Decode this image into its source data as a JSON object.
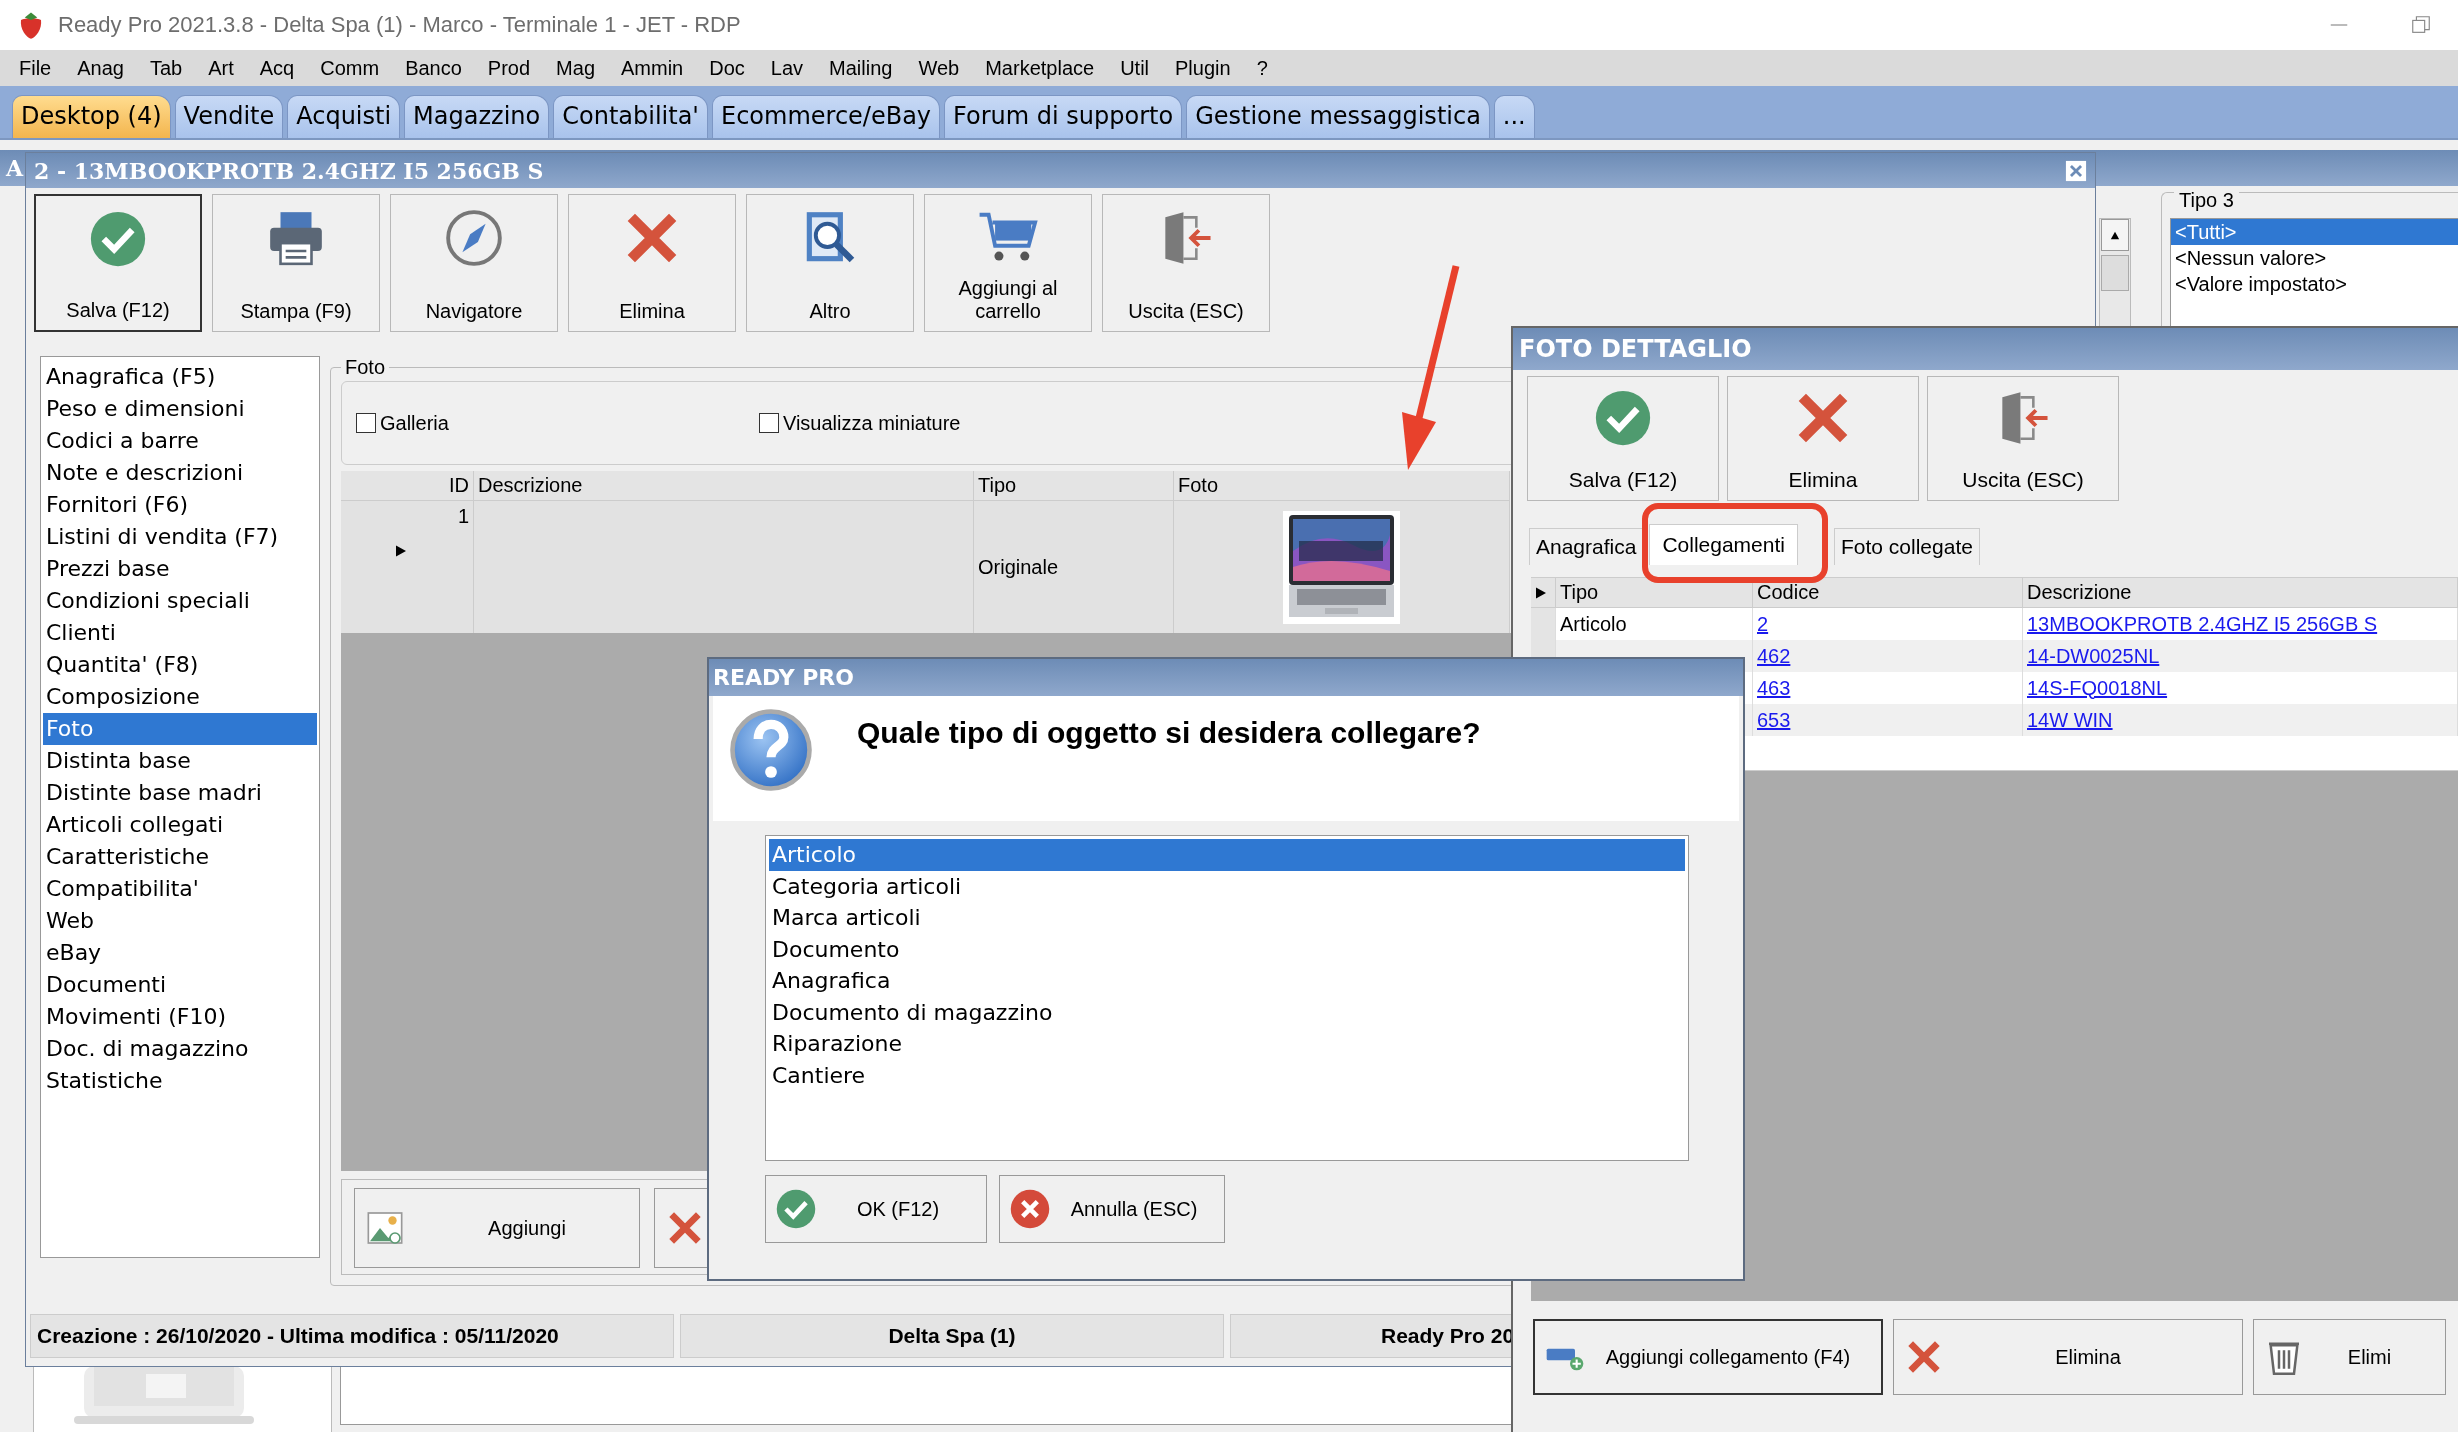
{
  "window": {
    "title": "Ready Pro 2021.3.8 - Delta Spa (1) - Marco - Terminale 1 - JET - RDP",
    "menu": [
      "File",
      "Anag",
      "Tab",
      "Art",
      "Acq",
      "Comm",
      "Banco",
      "Prod",
      "Mag",
      "Ammin",
      "Doc",
      "Lav",
      "Mailing",
      "Web",
      "Marketplace",
      "Util",
      "Plugin",
      "?"
    ],
    "tabs": [
      {
        "label": "Desktop (4)",
        "selected": true
      },
      {
        "label": "Vendite",
        "selected": false
      },
      {
        "label": "Acquisti",
        "selected": false
      },
      {
        "label": "Magazzino",
        "selected": false
      },
      {
        "label": "Contabilita'",
        "selected": false
      },
      {
        "label": "Ecommerce/eBay",
        "selected": false
      },
      {
        "label": "Forum di supporto",
        "selected": false
      },
      {
        "label": "Gestione messaggistica",
        "selected": false
      },
      {
        "label": "...",
        "selected": false
      }
    ]
  },
  "background_window": {
    "title": "A",
    "tipo3": {
      "title": "Tipo 3",
      "items": [
        {
          "label": "<Tutti>",
          "selected": true
        },
        {
          "label": "<Nessun valore>",
          "selected": false
        },
        {
          "label": "<Valore impostato>",
          "selected": false
        }
      ]
    }
  },
  "article_window": {
    "title": "2 - 13MBOOKPROTB 2.4GHZ I5 256GB S",
    "toolbar": [
      {
        "kind": "save",
        "label": "Salva (F12)",
        "focused": true
      },
      {
        "kind": "print",
        "label": "Stampa (F9)",
        "focused": false
      },
      {
        "kind": "navigate",
        "label": "Navigatore",
        "focused": false
      },
      {
        "kind": "delete",
        "label": "Elimina",
        "focused": false
      },
      {
        "kind": "search",
        "label": "Altro",
        "focused": false
      },
      {
        "kind": "cart",
        "label": "Aggiungi al carrello",
        "focused": false
      },
      {
        "kind": "exit",
        "label": "Uscita (ESC)",
        "focused": false
      }
    ],
    "sections": [
      {
        "label": "Anagrafica (F5)",
        "selected": false
      },
      {
        "label": "Peso e dimensioni",
        "selected": false
      },
      {
        "label": "Codici a barre",
        "selected": false
      },
      {
        "label": "Note e descrizioni",
        "selected": false
      },
      {
        "label": "Fornitori (F6)",
        "selected": false
      },
      {
        "label": "Listini di vendita (F7)",
        "selected": false
      },
      {
        "label": "Prezzi base",
        "selected": false
      },
      {
        "label": "Condizioni speciali",
        "selected": false
      },
      {
        "label": "Clienti",
        "selected": false
      },
      {
        "label": "Quantita' (F8)",
        "selected": false
      },
      {
        "label": "Composizione",
        "selected": false
      },
      {
        "label": "Foto",
        "selected": true
      },
      {
        "label": "Distinta base",
        "selected": false
      },
      {
        "label": "Distinte base madri",
        "selected": false
      },
      {
        "label": "Articoli collegati",
        "selected": false
      },
      {
        "label": "Caratteristiche",
        "selected": false
      },
      {
        "label": "Compatibilita'",
        "selected": false
      },
      {
        "label": "Web",
        "selected": false
      },
      {
        "label": "eBay",
        "selected": false
      },
      {
        "label": "Documenti",
        "selected": false
      },
      {
        "label": "Movimenti (F10)",
        "selected": false
      },
      {
        "label": "Doc. di magazzino",
        "selected": false
      },
      {
        "label": "Statistiche",
        "selected": false
      }
    ],
    "photo_group": {
      "title": "Foto",
      "checkboxes": [
        {
          "label": "Galleria",
          "checked": false
        },
        {
          "label": "Visualizza miniature",
          "checked": false
        }
      ],
      "grid": {
        "columns": [
          "ID",
          "Descrizione",
          "Tipo",
          "Foto"
        ],
        "rows": [
          {
            "current": true,
            "id": "1",
            "tipo": "Originale"
          }
        ]
      },
      "buttons": [
        {
          "kind": "image-add",
          "label": "Aggiungi"
        },
        {
          "kind": "delete"
        }
      ]
    },
    "status_bar": [
      "Creazione : 26/10/2020 - Ultima modifica : 05/11/2020",
      "Delta Spa (1)",
      "Ready Pro 20"
    ]
  },
  "photo_detail_window": {
    "title": "FOTO DETTAGLIO",
    "toolbar": [
      {
        "kind": "save",
        "label": "Salva (F12)"
      },
      {
        "kind": "delete",
        "label": "Elimina"
      },
      {
        "kind": "exit",
        "label": "Uscita (ESC)"
      }
    ],
    "tabs": [
      {
        "label": "Anagrafica",
        "selected": false
      },
      {
        "label": "Collegamenti",
        "selected": true
      },
      {
        "label": "Foto collegate",
        "selected": false
      }
    ],
    "grid": {
      "columns": [
        "Tipo",
        "Codice",
        "Descrizione"
      ],
      "rows": [
        {
          "tipo": "Articolo",
          "codice": "2",
          "descrizione": "13MBOOKPROTB 2.4GHZ I5 256GB S"
        },
        {
          "codice": "462",
          "descrizione": "14-DW0025NL"
        },
        {
          "codice": "463",
          "descrizione": "14S-FQ0018NL"
        },
        {
          "codice": "653",
          "descrizione": "14W WIN"
        }
      ]
    },
    "buttons": [
      {
        "kind": "link-add",
        "label": "Aggiungi collegamento (F4)",
        "focused": true
      },
      {
        "kind": "delete",
        "label": "Elimina",
        "focused": false
      },
      {
        "kind": "trash",
        "label": "Elimi",
        "focused": false
      }
    ]
  },
  "dialog": {
    "title": "READY PRO",
    "question": "Quale tipo di oggetto si desidera collegare?",
    "options": [
      {
        "label": "Articolo",
        "selected": true
      },
      {
        "label": "Categoria articoli",
        "selected": false
      },
      {
        "label": "Marca articoli",
        "selected": false
      },
      {
        "label": "Documento",
        "selected": false
      },
      {
        "label": "Anagrafica",
        "selected": false
      },
      {
        "label": "Documento di magazzino",
        "selected": false
      },
      {
        "label": "Riparazione",
        "selected": false
      },
      {
        "label": "Cantiere",
        "selected": false
      }
    ],
    "buttons": [
      {
        "kind": "ok",
        "label": "OK (F12)"
      },
      {
        "kind": "cancel",
        "label": "Annulla (ESC)"
      }
    ]
  },
  "annotations": {
    "arrow": true,
    "ring": true
  }
}
